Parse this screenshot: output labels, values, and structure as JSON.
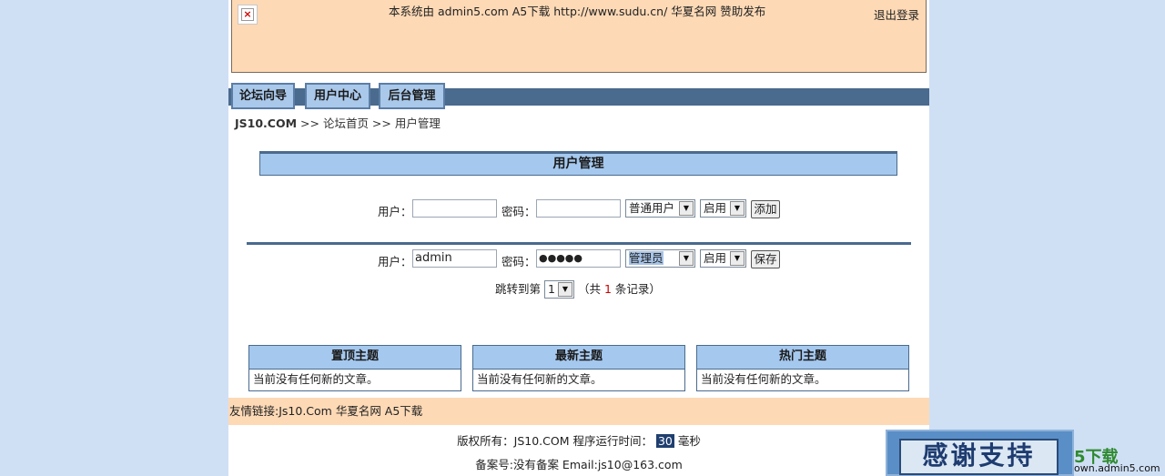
{
  "banner": {
    "notice": "本系统由 admin5.com A5下载 http://www.sudu.cn/ 华夏名网 赞助发布",
    "logout": "退出登录",
    "broken_image": "×"
  },
  "nav": {
    "tabs": [
      "论坛向导",
      "用户中心",
      "后台管理"
    ]
  },
  "breadcrumb": {
    "site": "JS10.COM",
    "trail": ">> 论坛首页 >> 用户管理"
  },
  "section_title": "用户管理",
  "add_form": {
    "user_label": "用户：",
    "user_value": "",
    "pass_label": "密码：",
    "pass_value": "",
    "role": "普通用户",
    "status": "启用",
    "submit": "添加"
  },
  "edit_form": {
    "user_label": "用户：",
    "user_value": "admin",
    "pass_label": "密码：",
    "pass_value": "●●●●●",
    "role": "管理员",
    "status": "启用",
    "submit": "保存"
  },
  "pager": {
    "prefix": "跳转到第",
    "page": "1",
    "total_prefix": "（共",
    "total": "1",
    "total_suffix": "条记录）"
  },
  "panels": [
    {
      "title": "置顶主题",
      "body": "当前没有任何新的文章。"
    },
    {
      "title": "最新主题",
      "body": "当前没有任何新的文章。"
    },
    {
      "title": "热门主题",
      "body": "当前没有任何新的文章。"
    }
  ],
  "links": {
    "label": "友情链接:",
    "items": "Js10.Com 华夏名网 A5下载"
  },
  "footer": {
    "copyright": "版权所有：JS10.COM 程序运行时间：",
    "ms": "30",
    "ms_unit": "毫秒",
    "icp": "备案号:没有备案 Email:js10@163.com"
  },
  "ad": {
    "text": "感谢支持",
    "side": "5下载",
    "url": "own.admin5.com"
  },
  "colors": {
    "banner_bg": "#fdd9b6",
    "nav_bar": "#4a6a8e",
    "header_blue": "#a5c8ee",
    "page_bg": "#cfe0f5"
  }
}
